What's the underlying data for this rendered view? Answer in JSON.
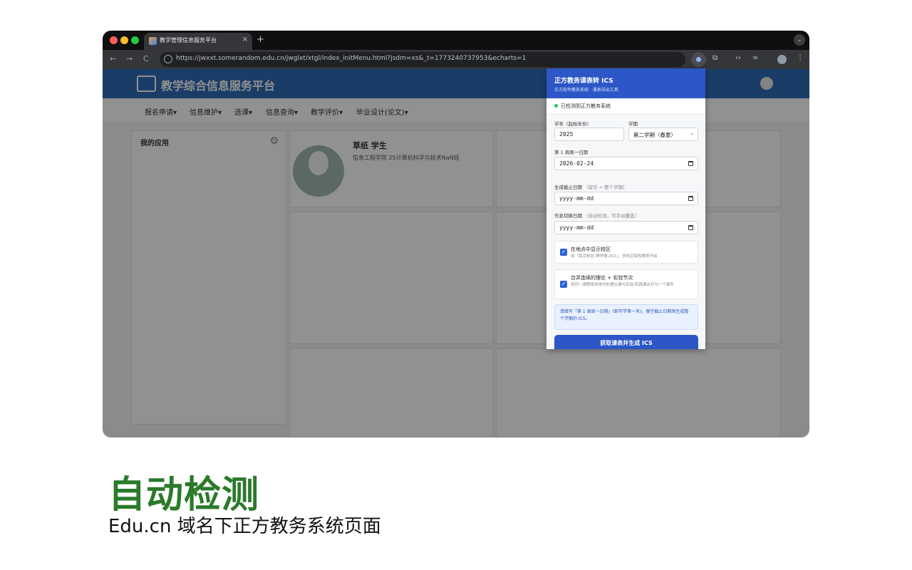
{
  "browser": {
    "tab_title": "教学管理信息服务平台",
    "tab_close": "×",
    "new_tab": "+",
    "tab_menu": "⌄",
    "back": "←",
    "forward": "→",
    "reload": "C",
    "url": "https://jwxxt.somerandom.edu.cn/jwglxt/xtgl/index_initMenu.html?jsdm=xs&_t=1773240737953&echarts=1",
    "toolbar_icons": [
      "⧉",
      "‹›",
      "∞",
      "⋮"
    ]
  },
  "site": {
    "title": "教学综合信息服务平台",
    "nav": [
      "报名申请▾",
      "信息维护▾",
      "选课▾",
      "信息查询▾",
      "教学评价▾",
      "毕业设计(论文)▾"
    ],
    "apps_title": "我的应用",
    "gear": "⚙",
    "profile_name": "草纸  学生",
    "profile_dept": "信息工程学院 25计算机科学与技术NaN班"
  },
  "popup": {
    "title": "正方教务课表转 ICS",
    "subtitle": "正方软件教务系统 · 课表导出工具",
    "status": "已检测到正方教务系统",
    "status_color": "#22c55e",
    "accent_color": "#2d57c7",
    "year_label": "学年（起始年份）",
    "year_value": "2025",
    "term_label": "学期",
    "term_value": "第二学期（春夏）",
    "week1_label": "第 1 周周一日期",
    "week1_value": "2026-02-24",
    "end_label": "生成截止日期",
    "end_hint": "（留空 = 整个学期）",
    "end_placeholder": "yyyy-mm-dd",
    "switch_label": "作息切换日期",
    "switch_hint": "（自动检测，可手动覆盖）",
    "switch_placeholder": "yyyy-mm-dd",
    "opt1_title": "在地点中显示校区",
    "opt1_desc": "如「南京校区·博学楼-202」，多校区院校推荐开启",
    "opt1_checked": true,
    "opt2_title": "合并连续的理论 + 实验节次",
    "opt2_desc": "将同一课程相邻排列的理论课与实验/实践课合并为一个事件",
    "opt2_checked": true,
    "info": "请填写「第 1 周周一日期」(即开学第一天)。留空截止日期则生成整个学期的 ICS。",
    "button": "获取课表并生成 ICS"
  },
  "caption": {
    "headline": "自动检测",
    "headline_color": "#2a7a2a",
    "subline": "Edu.cn 域名下正方教务系统页面"
  }
}
